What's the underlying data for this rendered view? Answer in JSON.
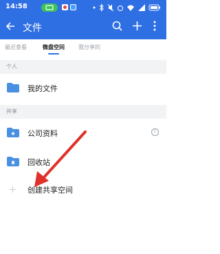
{
  "status_bar": {
    "time": "14:58"
  },
  "app_bar": {
    "title": "文件"
  },
  "tabs": [
    {
      "label": "最近查看"
    },
    {
      "label": "微盘空间",
      "active": true
    },
    {
      "label": "我分享的"
    }
  ],
  "sections": [
    {
      "title": "个人",
      "items": [
        {
          "label": "我的文件"
        }
      ]
    },
    {
      "title": "共享",
      "items": [
        {
          "label": "公司资料"
        },
        {
          "label": "回收站"
        },
        {
          "label": "创建共享空间"
        }
      ]
    }
  ],
  "colors": {
    "accent": "#2f6fe4",
    "folder": "#4a90e2",
    "annotation_arrow": "#e0302a"
  }
}
